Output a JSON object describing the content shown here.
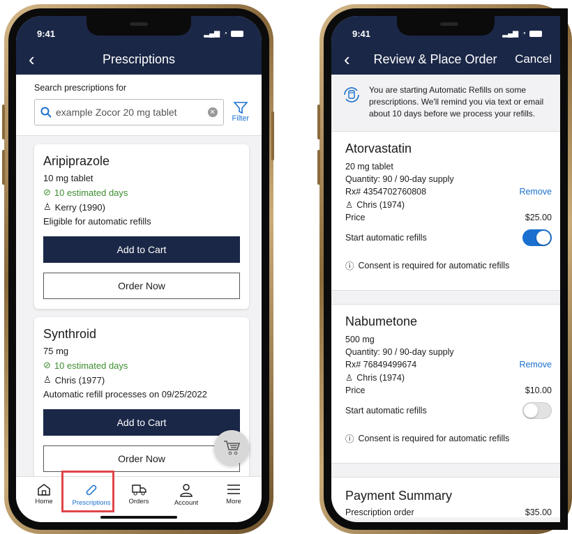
{
  "status": {
    "time": "9:41"
  },
  "left": {
    "title": "Prescriptions",
    "search": {
      "label": "Search prescriptions for",
      "placeholder": "example Zocor 20 mg tablet"
    },
    "filter_label": "Filter",
    "cards": [
      {
        "name": "Aripiprazole",
        "dose": "10 mg tablet",
        "days": "10 estimated days",
        "person": "Kerry (1990)",
        "note": "Eligible for automatic refills",
        "primary": "Add to Cart",
        "secondary": "Order Now"
      },
      {
        "name": "Synthroid",
        "dose": "75 mg",
        "days": "10 estimated days",
        "person": "Chris (1977)",
        "note": "Automatic refill processes on 09/25/2022",
        "primary": "Add to Cart",
        "secondary": "Order Now"
      }
    ],
    "tabs": [
      {
        "label": "Home",
        "icon": "home-icon"
      },
      {
        "label": "Prescriptions",
        "icon": "pill-icon"
      },
      {
        "label": "Orders",
        "icon": "delivery-truck-icon"
      },
      {
        "label": "Account",
        "icon": "person-icon"
      },
      {
        "label": "More",
        "icon": "menu-icon"
      }
    ],
    "active_tab": "Prescriptions"
  },
  "right": {
    "title": "Review & Place Order",
    "cancel": "Cancel",
    "info": "You are starting Automatic Refills on some prescriptions. We'll remind you via text or email about 10 days before we process your refills.",
    "items": [
      {
        "name": "Atorvastatin",
        "dose": "20 mg tablet",
        "quantity": "Quantity: 90 / 90-day supply",
        "rx": "Rx# 4354702760808",
        "remove": "Remove",
        "person": "Chris (1974)",
        "price_label": "Price",
        "price": "$25.00",
        "auto_label": "Start automatic refills",
        "auto_on": true,
        "consent": "Consent is required for automatic refills"
      },
      {
        "name": "Nabumetone",
        "dose": "500 mg",
        "quantity": "Quantity: 90 / 90-day supply",
        "rx": "Rx# 76849499674",
        "remove": "Remove",
        "person": "Chris (1974)",
        "price_label": "Price",
        "price": "$10.00",
        "auto_label": "Start automatic refills",
        "auto_on": false,
        "consent": "Consent is required for automatic refills"
      }
    ],
    "payment": {
      "title": "Payment Summary",
      "row_label": "Prescription order",
      "row_value": "$35.00"
    }
  },
  "colors": {
    "navy": "#1b2747",
    "accent": "#1a6fcf",
    "green": "#3d8d2f",
    "highlight": "#e0454a"
  }
}
